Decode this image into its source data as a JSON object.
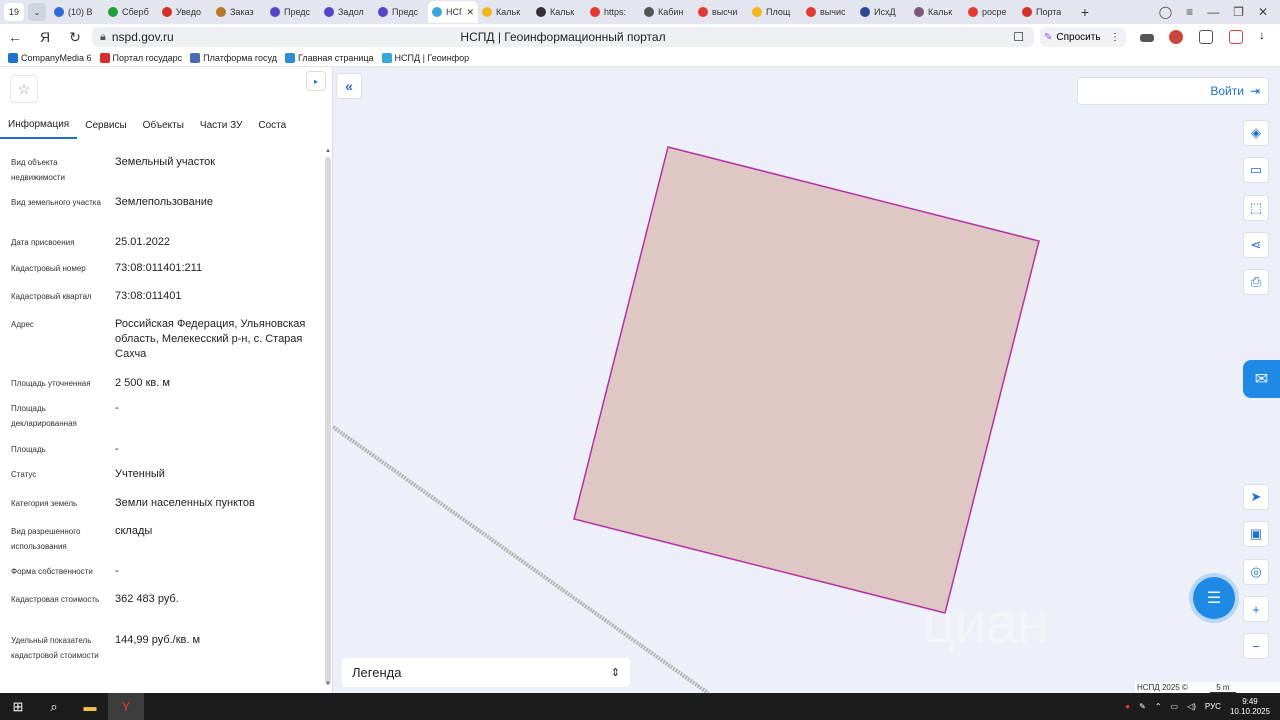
{
  "browser": {
    "tab_count": "19",
    "tabs": [
      {
        "label": "(10) B",
        "color": "#2e6cd8"
      },
      {
        "label": "Сберб",
        "color": "#21a038"
      },
      {
        "label": "Уведо",
        "color": "#d62d2d"
      },
      {
        "label": "Заказ",
        "color": "#b87a2a"
      },
      {
        "label": "Предс",
        "color": "#5546c8"
      },
      {
        "label": "Задол",
        "color": "#5546c8"
      },
      {
        "label": "Предс",
        "color": "#5546c8"
      },
      {
        "label": "НСП",
        "color": "#39a7d8"
      },
      {
        "label": "Кальк",
        "color": "#f1b71c"
      },
      {
        "label": "Кальк",
        "color": "#333333"
      },
      {
        "label": "https:",
        "color": "#e53935"
      },
      {
        "label": "Кабин",
        "color": "#555555"
      },
      {
        "label": "высчи",
        "color": "#e53935"
      },
      {
        "label": "Площ",
        "color": "#f1b71c"
      },
      {
        "label": "вычис",
        "color": "#e53935"
      },
      {
        "label": "ИсхД",
        "color": "#2a4b8d"
      },
      {
        "label": "Кальк",
        "color": "#7a5a7a"
      },
      {
        "label": "росре",
        "color": "#e53935"
      },
      {
        "label": "Порта",
        "color": "#d62d2d"
      }
    ],
    "active_tab_index": 7,
    "url": "nspd.gov.ru",
    "page_title": "НСПД | Геоинформационный портал",
    "ask_label": "Спросить",
    "bookmarks": [
      {
        "label": "CompanyMedia 6",
        "color": "#1f6fd1"
      },
      {
        "label": "Портал государс",
        "color": "#d62d2d"
      },
      {
        "label": "Платформа госуд",
        "color": "#4a6bb0"
      },
      {
        "label": "Главная страница",
        "color": "#2a8fd0"
      },
      {
        "label": "НСПД | Геоинфор",
        "color": "#39a7d8"
      }
    ]
  },
  "panel": {
    "tabs": [
      "Информация",
      "Сервисы",
      "Объекты",
      "Части ЗУ",
      "Соста"
    ],
    "active_tab_index": 0,
    "rows": [
      {
        "key": "Вид объекта недвижимости",
        "value": "Земельный участок"
      },
      {
        "key": "Вид земельного участка",
        "value": "Землепользование"
      },
      {
        "key": "Дата присвоения",
        "value": "25.01.2022"
      },
      {
        "key": "Кадастровый номер",
        "value": "73:08:011401:211"
      },
      {
        "key": "Кадастровый квартал",
        "value": "73:08:011401"
      },
      {
        "key": "Адрес",
        "value": "Российская Федерация, Ульяновская область, Мелекесский р-н, с. Старая Сахча"
      },
      {
        "key": "Площадь уточненная",
        "value": "2 500 кв. м"
      },
      {
        "key": "Площадь декларированная",
        "value": "-"
      },
      {
        "key": "Площадь",
        "value": "-"
      },
      {
        "key": "Статус",
        "value": "Учтенный"
      },
      {
        "key": "Категория земель",
        "value": "Земли населенных пунктов"
      },
      {
        "key": "Вид разрешенного использования",
        "value": "склады"
      },
      {
        "key": "Форма собственности",
        "value": "-"
      },
      {
        "key": "Кадастровая стоимость",
        "value": "362 483 руб."
      },
      {
        "key": "Удельный показатель кадастровой стоимости",
        "value": "144,99 руб./кв. м"
      }
    ]
  },
  "map": {
    "login_label": "Войти",
    "legend_label": "Легенда",
    "copyright": "НСПД 2025 ©",
    "scale_label": "5 m",
    "watermark": "циан",
    "parcel_fill": "#dfc8c4",
    "parcel_stroke": "#b530a8",
    "accent": "#1f6fd1"
  },
  "taskbar": {
    "lang": "РУС",
    "time": "9:49",
    "date": "10.10.2025"
  }
}
